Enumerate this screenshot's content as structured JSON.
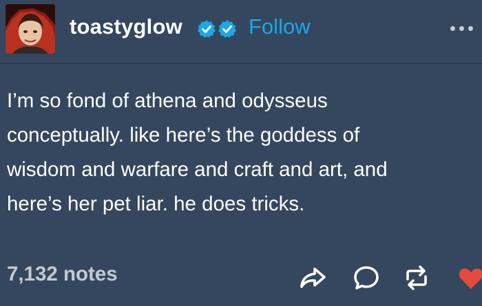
{
  "post": {
    "username": "toastyglow",
    "follow_label": "Follow",
    "body_lines": [
      "I’m so fond of athena and odysseus",
      "conceptually.  like here’s the goddess of",
      "wisdom and warfare and craft and art, and",
      "here’s her pet liar.  he does tricks."
    ],
    "notes": "7,132 notes"
  },
  "icons": {
    "badges": [
      "verified-check-icon",
      "verified-check-icon"
    ],
    "more": "ellipsis-icon",
    "share": "share-arrow-icon",
    "reply": "reply-bubble-icon",
    "reblog": "reblog-icon",
    "like": "heart-icon"
  },
  "colors": {
    "background": "#35475e",
    "text": "#ffffff",
    "follow": "#1aa8e8",
    "badge": "#1aa8e8",
    "muted": "#c3cad3",
    "heart": "#e44b3b"
  }
}
